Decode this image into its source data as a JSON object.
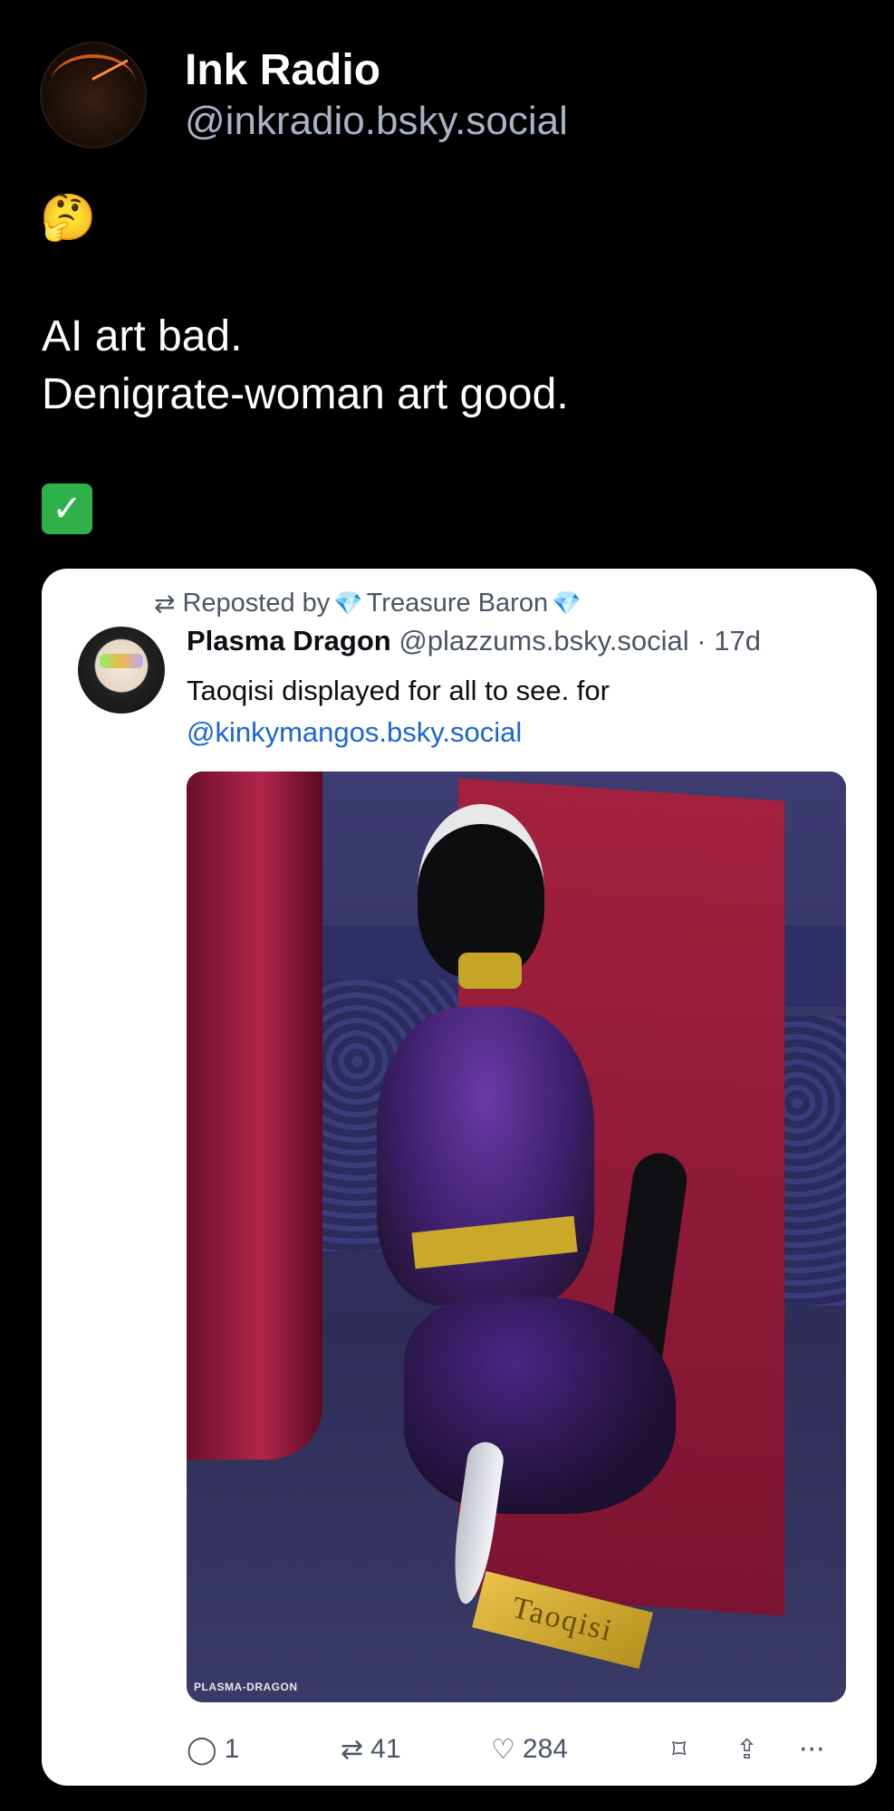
{
  "author": {
    "display_name": "Ink Radio",
    "handle": "@inkradio.bsky.social"
  },
  "post": {
    "emoji_top": "🤔",
    "lines": [
      "AI art bad.",
      "Denigrate-woman art good."
    ],
    "emoji_bottom": "✓"
  },
  "quoted": {
    "repost_prefix": "Reposted by",
    "reposter_name": "Treasure Baron",
    "gem": "💎",
    "display_name": "Plasma Dragon",
    "handle": "@plazzums.bsky.social",
    "separator": "·",
    "age": "17d",
    "text": "Taoqisi displayed for all to see. for",
    "mention": "@kinkymangos.bsky.social",
    "image": {
      "plaque_text": "Taoqisi",
      "watermark": "PLASMA-DRAGON"
    },
    "actions": {
      "reply_count": "1",
      "repost_count": "41",
      "like_count": "284"
    }
  },
  "icons": {
    "repost": "⇄",
    "reply": "◯",
    "like": "♡",
    "bookmark": "⌑",
    "share": "⇪",
    "more": "···"
  }
}
